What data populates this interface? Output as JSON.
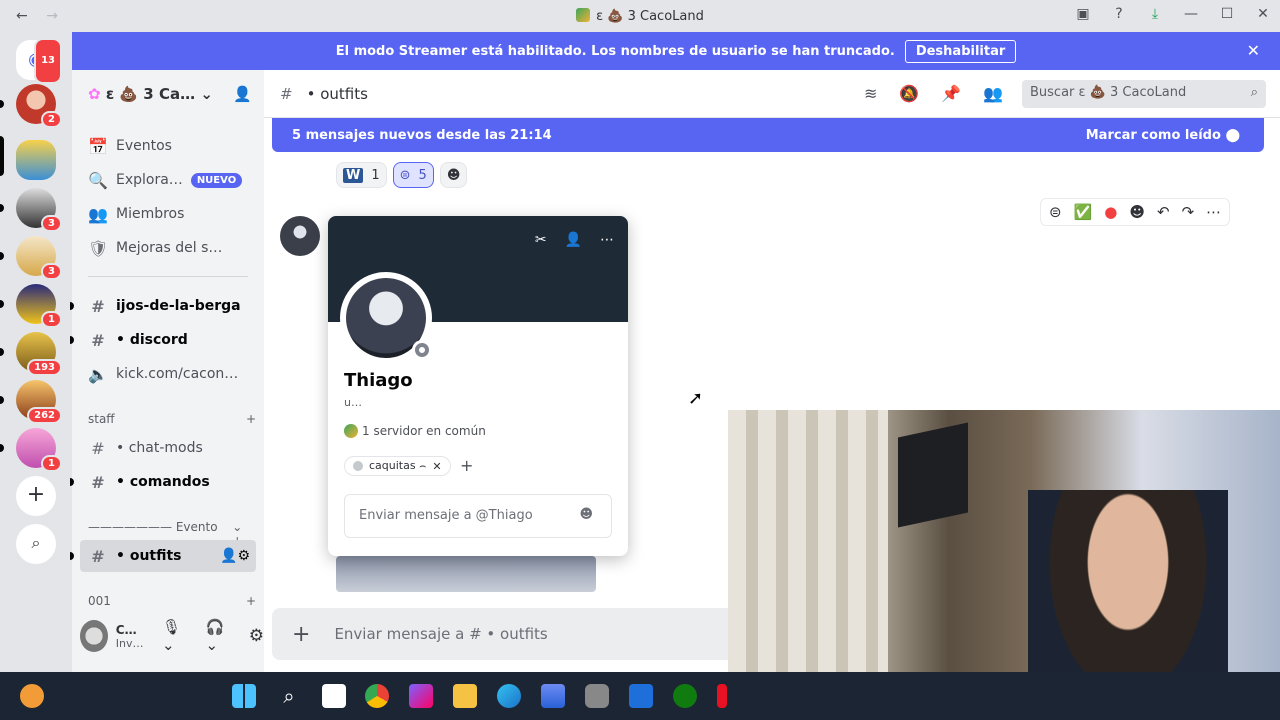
{
  "window": {
    "title": "ε 💩 3 CacoLand",
    "back": "←",
    "forward": "→"
  },
  "banner": {
    "text": "El modo Streamer está habilitado. Los nombres de usuario se han truncado.",
    "button": "Deshabilitar",
    "close": "✕"
  },
  "guilds": {
    "badges": [
      "13",
      "2",
      "3",
      "3",
      "1",
      "193",
      "262",
      "1"
    ],
    "add": "+"
  },
  "server": {
    "name": "ε 💩 3 Ca…"
  },
  "sidebar": {
    "items": [
      {
        "icon": "📅",
        "label": "Eventos"
      },
      {
        "icon": "🔍",
        "label": "Explora…",
        "badge": "NUEVO"
      },
      {
        "icon": "👥",
        "label": "Miembros"
      },
      {
        "icon": "🛡",
        "label": "Mejoras del s…"
      }
    ],
    "channels1": [
      {
        "label": "ijos-de-la-berga"
      },
      {
        "label": "• discord"
      },
      {
        "label": "kick.com/cacon…"
      }
    ],
    "cat_staff": "staff",
    "channels2": [
      {
        "label": "• chat-mods"
      },
      {
        "label": "• comandos"
      }
    ],
    "cat_evento": "——————— Evento …",
    "selected": "• outfits",
    "cat_001": "001"
  },
  "user": {
    "name": "C…",
    "status": "Inv…"
  },
  "chat": {
    "channel": "• outfits",
    "search_placeholder": "Buscar ε 💩 3 CacoLand",
    "new_messages": "5 mensajes nuevos desde las 21:14",
    "mark_read": "Marcar como leído",
    "reactions": [
      {
        "emoji": "W",
        "count": "1"
      },
      {
        "emoji": "⊜",
        "count": "5"
      }
    ],
    "composer_placeholder": "Enviar mensaje a # • outfits"
  },
  "profile": {
    "name": "Thiago",
    "username": "u…",
    "mutual": "1 servidor en común",
    "role": "caquitas ⌢",
    "message_placeholder": "Enviar mensaje a @Thiago"
  },
  "colors": {
    "accent": "#5865f2",
    "danger": "#f23f42",
    "taskbar": "#1c2533"
  }
}
